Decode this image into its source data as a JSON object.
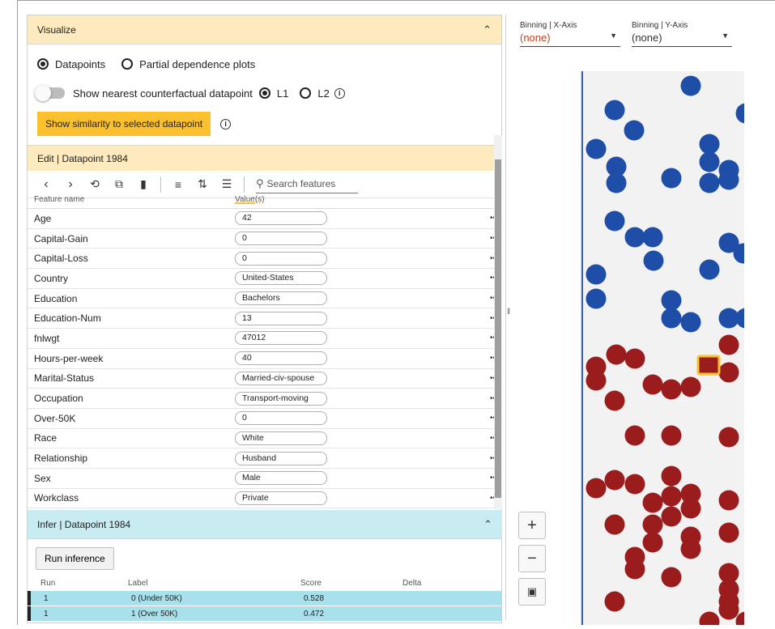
{
  "visualize": {
    "title": "Visualize",
    "mode_datapoints": "Datapoints",
    "mode_pdp": "Partial dependence plots",
    "nearest_toggle": "Show nearest counterfactual datapoint",
    "l1": "L1",
    "l2": "L2",
    "similarity_button": "Show similarity to selected datapoint"
  },
  "edit": {
    "title": "Edit | Datapoint 1984",
    "search_placeholder": "Search features",
    "col_name": "Feature name",
    "col_value": "Value(s)",
    "features": [
      {
        "name": "Age",
        "value": "42"
      },
      {
        "name": "Capital-Gain",
        "value": "0"
      },
      {
        "name": "Capital-Loss",
        "value": "0"
      },
      {
        "name": "Country",
        "value": "United-States"
      },
      {
        "name": "Education",
        "value": "Bachelors"
      },
      {
        "name": "Education-Num",
        "value": "13"
      },
      {
        "name": "fnlwgt",
        "value": "47012"
      },
      {
        "name": "Hours-per-week",
        "value": "40"
      },
      {
        "name": "Marital-Status",
        "value": "Married-civ-spouse"
      },
      {
        "name": "Occupation",
        "value": "Transport-moving"
      },
      {
        "name": "Over-50K",
        "value": "0"
      },
      {
        "name": "Race",
        "value": "White"
      },
      {
        "name": "Relationship",
        "value": "Husband"
      },
      {
        "name": "Sex",
        "value": "Male"
      },
      {
        "name": "Workclass",
        "value": "Private"
      }
    ]
  },
  "infer": {
    "title": "Infer | Datapoint 1984",
    "run_button": "Run inference",
    "headers": [
      "Run",
      "Label",
      "Score",
      "Delta"
    ],
    "rows": [
      {
        "run": "1",
        "label": "0 (Under 50K)",
        "score": "0.528",
        "delta": ""
      },
      {
        "run": "1",
        "label": "1 (Over 50K)",
        "score": "0.472",
        "delta": ""
      }
    ]
  },
  "binning": {
    "x_label": "Binning | X-Axis",
    "x_value": "(none)",
    "y_label": "Binning | Y-Axis",
    "y_value": "(none)"
  },
  "colors": {
    "blue_point": "#1f4ea8",
    "red_point": "#9b1c1c",
    "selected_outline": "#fbc02d",
    "visualize_header": "#fdebbf",
    "infer_header": "#c9ecf3",
    "x_binning_value": "#c2421a"
  }
}
